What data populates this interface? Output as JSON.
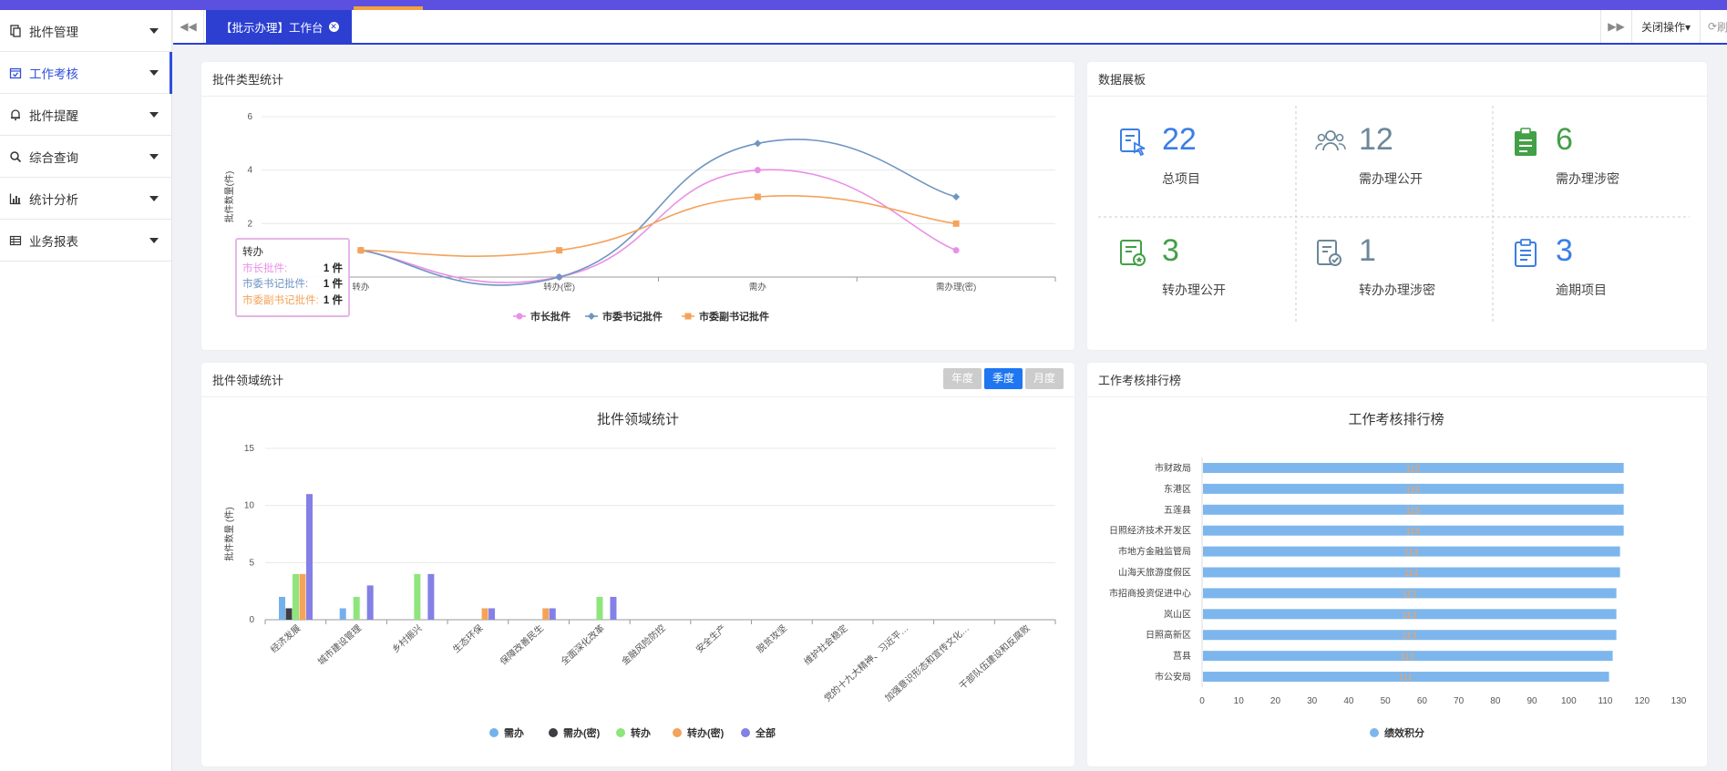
{
  "sidebar": {
    "items": [
      {
        "label": "批件管理",
        "icon": "document-stack-icon"
      },
      {
        "label": "工作考核",
        "icon": "calendar-check-icon"
      },
      {
        "label": "批件提醒",
        "icon": "bell-icon"
      },
      {
        "label": "综合查询",
        "icon": "search-icon"
      },
      {
        "label": "统计分析",
        "icon": "bar-chart-icon"
      },
      {
        "label": "业务报表",
        "icon": "table-icon"
      }
    ]
  },
  "tabs": {
    "active_label": "【批示办理】工作台",
    "close_ops": "关闭操作▾",
    "refresh": "刷新"
  },
  "panel_type": {
    "title": "批件类型统计",
    "tooltip": {
      "title": "转办",
      "rows": [
        {
          "label": "市长批件:",
          "value": "1 件",
          "color": "#e990e7"
        },
        {
          "label": "市委书记批件:",
          "value": "1 件",
          "color": "#6f95c2"
        },
        {
          "label": "市委副书记批件:",
          "value": "1 件",
          "color": "#f4a35a"
        }
      ]
    }
  },
  "panel_dashboard": {
    "title": "数据展板",
    "stats": [
      {
        "value": "22",
        "label": "总项目",
        "color": "#3a7ee6",
        "icon": "touch-document-icon"
      },
      {
        "value": "12",
        "label": "需办理公开",
        "color": "#6c8797",
        "icon": "people-group-icon"
      },
      {
        "value": "6",
        "label": "需办理涉密",
        "color": "#43a047",
        "icon": "clipboard-icon"
      },
      {
        "value": "3",
        "label": "转办理公开",
        "color": "#43a047",
        "icon": "certificate-icon"
      },
      {
        "value": "1",
        "label": "转办办理涉密",
        "color": "#6c8797",
        "icon": "document-check-icon"
      },
      {
        "value": "3",
        "label": "逾期项目",
        "color": "#3a7ee6",
        "icon": "document-list-icon"
      }
    ]
  },
  "panel_domain": {
    "title": "批件领域统计",
    "seg": [
      "年度",
      "季度",
      "月度"
    ]
  },
  "panel_rank": {
    "title": "工作考核排行榜"
  },
  "chart_data": [
    {
      "type": "line",
      "categories": [
        "转办",
        "转办(密)",
        "需办",
        "需办理(密)"
      ],
      "ylabel": "批件数量(件)",
      "ylim": [
        0,
        6
      ],
      "yticks": [
        0,
        2,
        4,
        6
      ],
      "legend": "bottom",
      "series": [
        {
          "name": "市长批件",
          "values": [
            1,
            0,
            4,
            1
          ],
          "color": "#e990e7"
        },
        {
          "name": "市委书记批件",
          "values": [
            1,
            0,
            5,
            3
          ],
          "color": "#6f95c2"
        },
        {
          "name": "市委副书记批件",
          "values": [
            1,
            1,
            3,
            2
          ],
          "color": "#f4a35a"
        }
      ]
    },
    {
      "type": "bar",
      "title": "批件领域统计",
      "ylabel": "批件数量 (件)",
      "ylim": [
        0,
        15
      ],
      "yticks": [
        0,
        5,
        10,
        15
      ],
      "legend": "bottom",
      "categories": [
        "经济发展",
        "城市建设管理",
        "乡村振兴",
        "生态环保",
        "保障改善民生",
        "全面深化改革",
        "金融风险防控",
        "安全生产",
        "脱贫攻坚",
        "维护社会稳定",
        "党的十九大精神、习近平…",
        "加强意识形态和宣传文化…",
        "干部队伍建设和反腐败"
      ],
      "series": [
        {
          "name": "需办",
          "values": [
            2,
            1,
            0,
            0,
            0,
            0,
            0,
            0,
            0,
            0,
            0,
            0,
            0
          ],
          "color": "#74b1ec"
        },
        {
          "name": "需办(密)",
          "values": [
            1,
            0,
            0,
            0,
            0,
            0,
            0,
            0,
            0,
            0,
            0,
            0,
            0
          ],
          "color": "#3d3d44"
        },
        {
          "name": "转办",
          "values": [
            4,
            2,
            4,
            0,
            0,
            2,
            0,
            0,
            0,
            0,
            0,
            0,
            0
          ],
          "color": "#8ee57c"
        },
        {
          "name": "转办(密)",
          "values": [
            4,
            0,
            0,
            1,
            1,
            0,
            0,
            0,
            0,
            0,
            0,
            0,
            0
          ],
          "color": "#f4a35a"
        },
        {
          "name": "全部",
          "values": [
            11,
            3,
            4,
            1,
            1,
            2,
            0,
            0,
            0,
            0,
            0,
            0,
            0
          ],
          "color": "#8480e6"
        }
      ]
    },
    {
      "type": "bar",
      "orientation": "horizontal",
      "title": "工作考核排行榜",
      "xlim": [
        0,
        130
      ],
      "xticks": [
        0,
        10,
        20,
        30,
        40,
        50,
        60,
        70,
        80,
        90,
        100,
        110,
        120,
        130
      ],
      "legend": "bottom",
      "categories": [
        "市财政局",
        "东港区",
        "五莲县",
        "日照经济技术开发区",
        "市地方金融监管局",
        "山海天旅游度假区",
        "市招商投资促进中心",
        "岚山区",
        "日照高新区",
        "莒县",
        "市公安局"
      ],
      "series": [
        {
          "name": "绩效积分",
          "values": [
            115,
            115,
            115,
            115,
            114,
            114,
            113,
            113,
            113,
            112,
            111
          ],
          "color": "#7db6ed"
        }
      ]
    }
  ]
}
